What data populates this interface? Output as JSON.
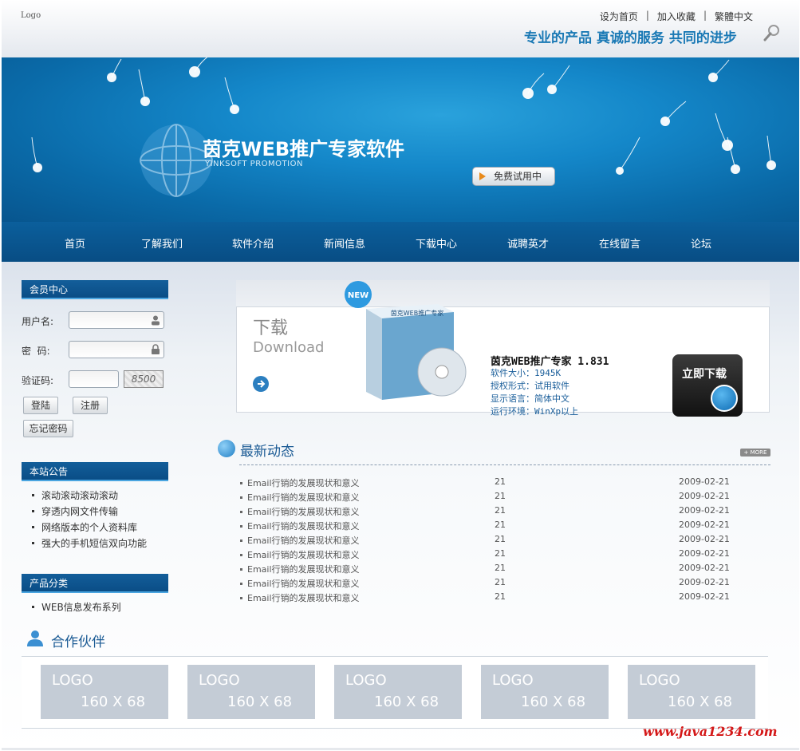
{
  "header": {
    "logo": "Logo",
    "links": [
      "设为首页",
      "加入收藏",
      "繁體中文"
    ],
    "separator": "|",
    "slogan": "专业的产品  真诚的服务  共同的进步"
  },
  "banner": {
    "title": "茵克WEB推广专家软件",
    "subtitle": "YINKSOFT PROMOTION",
    "trial_button": "免费试用中"
  },
  "nav": [
    "首页",
    "了解我们",
    "软件介绍",
    "新闻信息",
    "下载中心",
    "诚聘英才",
    "在线留言",
    "论坛"
  ],
  "member": {
    "title": "会员中心",
    "username_label": "用户名:",
    "password_label": "密  码:",
    "captcha_label": "验证码:",
    "captcha_text": "8500",
    "login_button": "登陆",
    "register_button": "注册",
    "forgot_button": "忘记密码"
  },
  "announcements": {
    "title": "本站公告",
    "items": [
      "滚动滚动滚动滚动",
      "穿透内网文件传输",
      "网络版本的个人资料库",
      "强大的手机短信双向功能"
    ]
  },
  "categories": {
    "title": "产品分类",
    "items": [
      "WEB信息发布系列"
    ]
  },
  "download": {
    "title_cn": "下载",
    "title_en": "Download",
    "box_badge": "NEW",
    "box_label": "茵克WEB推广专家",
    "product_name": "茵克WEB推广专家  1.831",
    "size": "软件大小：1945K",
    "license": "授权形式：试用软件",
    "language": "显示语言：简体中文",
    "env": "运行环境：WinXp以上",
    "download_now": "立即下载"
  },
  "news": {
    "title": "最新动态",
    "more": "+ MORE",
    "rows": [
      {
        "title": "Email行销的发展现状和意义",
        "count": "21",
        "date": "2009-02-21"
      },
      {
        "title": "Email行销的发展现状和意义",
        "count": "21",
        "date": "2009-02-21"
      },
      {
        "title": "Email行销的发展现状和意义",
        "count": "21",
        "date": "2009-02-21"
      },
      {
        "title": "Email行销的发展现状和意义",
        "count": "21",
        "date": "2009-02-21"
      },
      {
        "title": "Email行销的发展现状和意义",
        "count": "21",
        "date": "2009-02-21"
      },
      {
        "title": "Email行销的发展现状和意义",
        "count": "21",
        "date": "2009-02-21"
      },
      {
        "title": "Email行销的发展现状和意义",
        "count": "21",
        "date": "2009-02-21"
      },
      {
        "title": "Email行销的发展现状和意义",
        "count": "21",
        "date": "2009-02-21"
      },
      {
        "title": "Email行销的发展现状和意义",
        "count": "21",
        "date": "2009-02-21"
      }
    ]
  },
  "partners": {
    "title": "合作伙伴",
    "logos": [
      {
        "line1": "LOGO",
        "line2": "160 X 68"
      },
      {
        "line1": "LOGO",
        "line2": "160 X 68"
      },
      {
        "line1": "LOGO",
        "line2": "160 X 68"
      },
      {
        "line1": "LOGO",
        "line2": "160 X 68"
      },
      {
        "line1": "LOGO",
        "line2": "160 X 68"
      }
    ]
  },
  "watermark": "www.java1234.com"
}
